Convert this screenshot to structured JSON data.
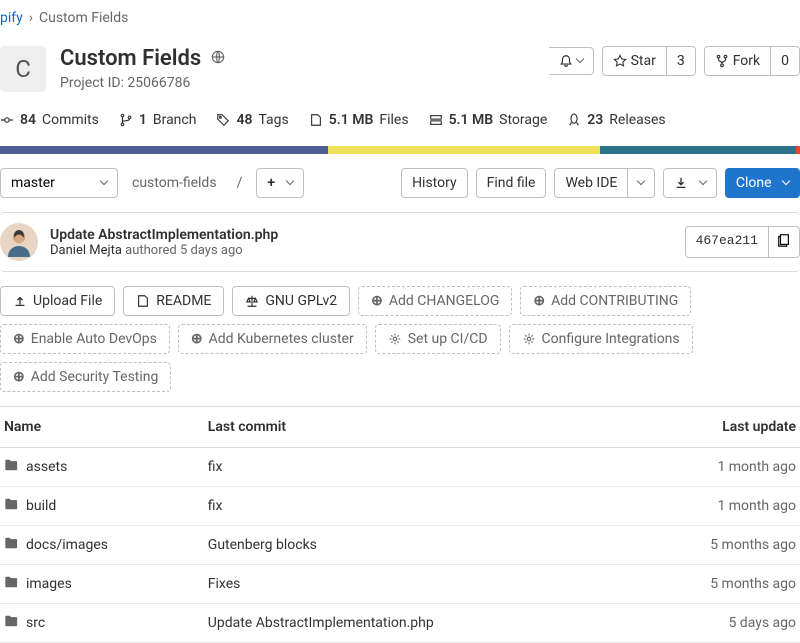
{
  "breadcrumb": {
    "parent": "pify",
    "current": "Custom Fields"
  },
  "project": {
    "icon_letter": "C",
    "title": "Custom Fields",
    "id_label": "Project ID: 25066786"
  },
  "header_actions": {
    "star_label": "Star",
    "star_count": "3",
    "fork_label": "Fork",
    "fork_count": "0"
  },
  "stats": {
    "commits_n": "84",
    "commits_l": "Commits",
    "branch_n": "1",
    "branch_l": "Branch",
    "tags_n": "48",
    "tags_l": "Tags",
    "files_n": "5.1 MB",
    "files_l": "Files",
    "storage_n": "5.1 MB",
    "storage_l": "Storage",
    "releases_n": "23",
    "releases_l": "Releases"
  },
  "repo": {
    "branch": "master",
    "path": "custom-fields",
    "slash": "/",
    "history": "History",
    "find": "Find file",
    "webide": "Web IDE",
    "clone": "Clone"
  },
  "commit": {
    "title": "Update AbstractImplementation.php",
    "author": "Daniel Mejta",
    "authored": "authored",
    "when": "5 days ago",
    "sha": "467ea211"
  },
  "chips": {
    "upload": "Upload File",
    "readme": "README",
    "license": "GNU GPLv2",
    "changelog": "Add CHANGELOG",
    "contributing": "Add CONTRIBUTING",
    "autodevops": "Enable Auto DevOps",
    "k8s": "Add Kubernetes cluster",
    "cicd": "Set up CI/CD",
    "integrations": "Configure Integrations",
    "security": "Add Security Testing"
  },
  "columns": {
    "name": "Name",
    "commit": "Last commit",
    "update": "Last update"
  },
  "rows": [
    {
      "name": "assets",
      "commit": "fix",
      "when": "1 month ago"
    },
    {
      "name": "build",
      "commit": "fix",
      "when": "1 month ago"
    },
    {
      "name": "docs/images",
      "commit": "Gutenberg blocks",
      "when": "5 months ago"
    },
    {
      "name": "images",
      "commit": "Fixes",
      "when": "5 months ago"
    },
    {
      "name": "src",
      "commit": "Update AbstractImplementation.php",
      "when": "5 days ago"
    }
  ]
}
